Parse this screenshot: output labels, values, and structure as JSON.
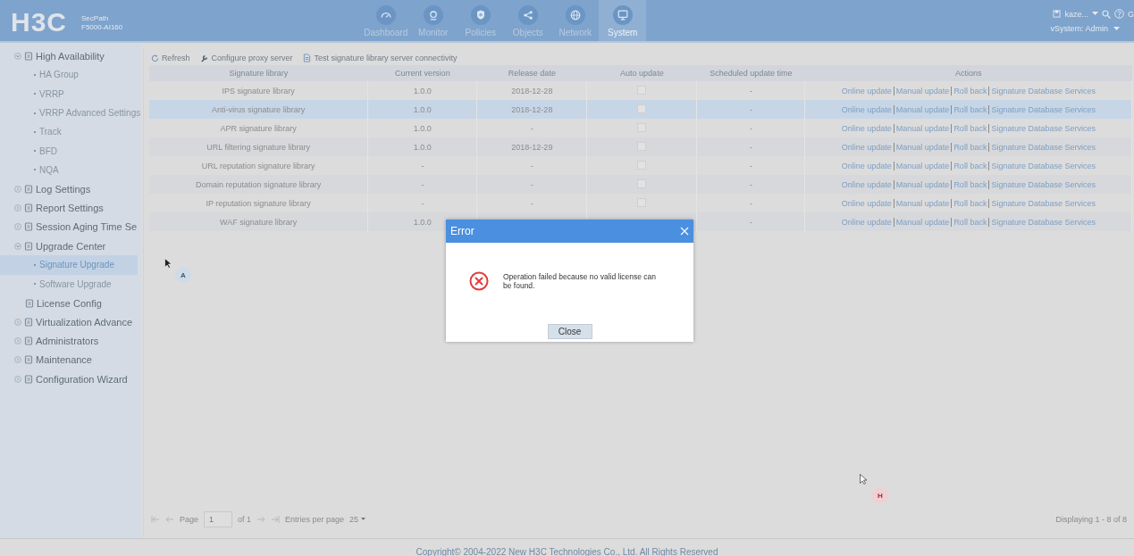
{
  "header": {
    "brand": "H3C",
    "product_line": "SecPath",
    "model": "F5000-AI160",
    "nav": [
      {
        "label": "Dashboard",
        "selected": false
      },
      {
        "label": "Monitor",
        "selected": false
      },
      {
        "label": "Policies",
        "selected": false
      },
      {
        "label": "Objects",
        "selected": false
      },
      {
        "label": "Network",
        "selected": false
      },
      {
        "label": "System",
        "selected": true
      }
    ],
    "user": "kaze...",
    "edge_text": "G",
    "vsystem": "vSystem: Admin"
  },
  "sidebar": {
    "items": [
      {
        "label": "High Availability",
        "expanded": true,
        "children": [
          {
            "label": "HA Group",
            "selected": false
          },
          {
            "label": "VRRP",
            "selected": false
          },
          {
            "label": "VRRP Advanced Settings",
            "selected": false
          },
          {
            "label": "Track",
            "selected": false
          },
          {
            "label": "BFD",
            "selected": false
          },
          {
            "label": "NQA",
            "selected": false
          }
        ]
      },
      {
        "label": "Log Settings",
        "expanded": false
      },
      {
        "label": "Report Settings",
        "expanded": false
      },
      {
        "label": "Session Aging Time Se",
        "expanded": false
      },
      {
        "label": "Upgrade Center",
        "expanded": true,
        "children": [
          {
            "label": "Signature Upgrade",
            "selected": true
          },
          {
            "label": "Software Upgrade",
            "selected": false
          }
        ]
      },
      {
        "label": "License Config",
        "kind": "leaf"
      },
      {
        "label": "Virtualization Advance",
        "expanded": false
      },
      {
        "label": "Administrators",
        "expanded": false
      },
      {
        "label": "Maintenance",
        "expanded": false
      },
      {
        "label": "Configuration Wizard",
        "expanded": false
      }
    ]
  },
  "toolbar": [
    "Refresh",
    "Configure proxy server",
    "Test signature library server connectivity"
  ],
  "table": {
    "columns": [
      "Signature library",
      "Current version",
      "Release date",
      "Auto update",
      "Scheduled update time",
      "Actions"
    ],
    "rows": [
      {
        "library": "IPS signature library",
        "version": "1.0.0",
        "date": "2018-12-28",
        "auto_update": false,
        "scheduled": "-",
        "selected": false,
        "actions": [
          "Online update",
          "Manual update",
          "Roll back",
          "Signature Database Services"
        ]
      },
      {
        "library": "Anti-virus signature library",
        "version": "1.0.0",
        "date": "2018-12-28",
        "auto_update": false,
        "scheduled": "-",
        "selected": true,
        "actions": [
          "Online update",
          "Manual update",
          "Roll back",
          "Signature Database Services"
        ]
      },
      {
        "library": "APR signature library",
        "version": "1.0.0",
        "date": "-",
        "auto_update": false,
        "scheduled": "-",
        "selected": false,
        "actions": [
          "Online update",
          "Manual update",
          "Roll back",
          "Signature Database Services"
        ]
      },
      {
        "library": "URL filtering signature library",
        "version": "1.0.0",
        "date": "2018-12-29",
        "auto_update": false,
        "scheduled": "-",
        "selected": false,
        "actions": [
          "Online update",
          "Manual update",
          "Roll back",
          "Signature Database Services"
        ]
      },
      {
        "library": "URL reputation signature library",
        "version": "-",
        "date": "-",
        "auto_update": false,
        "scheduled": "-",
        "selected": false,
        "actions": [
          "Online update",
          "Manual update",
          "Roll back",
          "Signature Database Services"
        ]
      },
      {
        "library": "Domain reputation signature library",
        "version": "-",
        "date": "-",
        "auto_update": false,
        "scheduled": "-",
        "selected": false,
        "actions": [
          "Online update",
          "Manual update",
          "Roll back",
          "Signature Database Services"
        ]
      },
      {
        "library": "IP reputation signature library",
        "version": "-",
        "date": "-",
        "auto_update": false,
        "scheduled": "-",
        "selected": false,
        "actions": [
          "Online update",
          "Manual update",
          "Roll back",
          "Signature Database Services"
        ]
      },
      {
        "library": "WAF signature library",
        "version": "1.0.0",
        "scheduled": "-",
        "selected": false,
        "actions": [
          "Online update",
          "Manual update",
          "Roll back",
          "Signature Database Services"
        ]
      }
    ]
  },
  "pagination": {
    "page_label": "Page",
    "page": "1",
    "of": "of 1",
    "entries_label": "Entries per page",
    "entries": "25",
    "summary": "Displaying 1 - 8 of 8"
  },
  "markers": [
    "A",
    "H"
  ],
  "dialog": {
    "title": "Error",
    "message": "Operation failed because no valid license can be found.",
    "button": "Close"
  },
  "footer": "Copyright© 2004-2022 New H3C Technologies Co., Ltd. All Rights Reserved"
}
